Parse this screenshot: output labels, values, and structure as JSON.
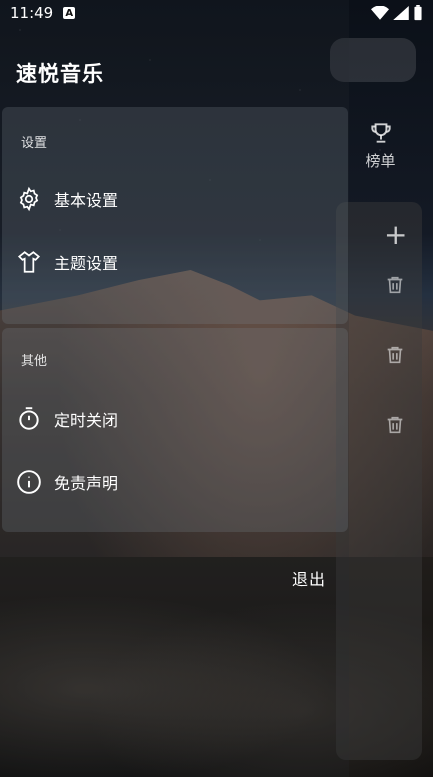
{
  "status_bar": {
    "time": "11:49",
    "notification_icon": "A"
  },
  "app": {
    "title": "速悦音乐"
  },
  "drawer": {
    "settings_section": {
      "header": "设置",
      "items": [
        {
          "label": "基本设置",
          "icon": "gear-icon"
        },
        {
          "label": "主题设置",
          "icon": "shirt-icon"
        }
      ]
    },
    "other_section": {
      "header": "其他",
      "items": [
        {
          "label": "定时关闭",
          "icon": "stopwatch-icon"
        },
        {
          "label": "免责声明",
          "icon": "info-icon"
        }
      ]
    },
    "logout": "退出"
  },
  "background": {
    "rank_label": "榜单"
  }
}
